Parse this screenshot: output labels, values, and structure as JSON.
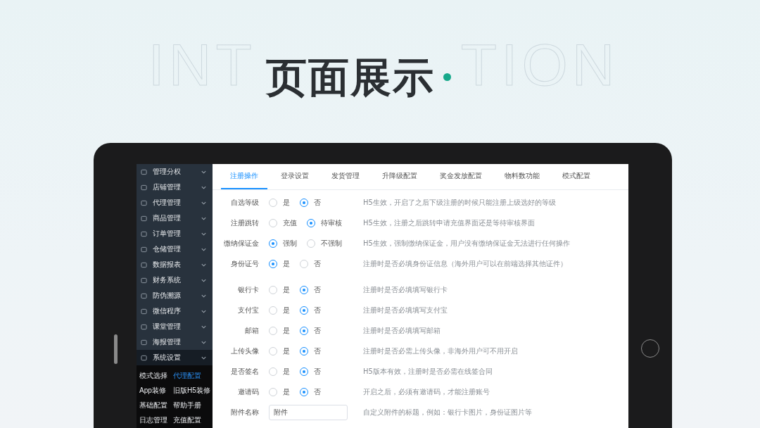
{
  "header": {
    "background_word_parts": [
      "INT",
      "TION"
    ],
    "title": "页面展示"
  },
  "sidebar": {
    "items": [
      {
        "label": "管理分权",
        "expanded": false
      },
      {
        "label": "店铺管理",
        "expanded": false
      },
      {
        "label": "代理管理",
        "expanded": false
      },
      {
        "label": "商品管理",
        "expanded": false
      },
      {
        "label": "订单管理",
        "expanded": false
      },
      {
        "label": "仓储管理",
        "expanded": false
      },
      {
        "label": "数据报表",
        "expanded": false
      },
      {
        "label": "财务系统",
        "expanded": false
      },
      {
        "label": "防伪溯源",
        "expanded": false
      },
      {
        "label": "微信程序",
        "expanded": false
      },
      {
        "label": "课堂管理",
        "expanded": false
      },
      {
        "label": "海报管理",
        "expanded": false
      },
      {
        "label": "系统设置",
        "expanded": true
      }
    ],
    "submenu": [
      {
        "label": "模式选择",
        "selected": false
      },
      {
        "label": "代理配置",
        "selected": true
      },
      {
        "label": "App装修",
        "selected": false
      },
      {
        "label": "旧版H5装修",
        "selected": false
      },
      {
        "label": "基础配置",
        "selected": false
      },
      {
        "label": "帮助手册",
        "selected": false
      },
      {
        "label": "日志管理",
        "selected": false
      },
      {
        "label": "充值配置",
        "selected": false
      }
    ]
  },
  "tabs": [
    {
      "label": "注册操作",
      "selected": true
    },
    {
      "label": "登录设置",
      "selected": false
    },
    {
      "label": "发货管理",
      "selected": false
    },
    {
      "label": "升降级配置",
      "selected": false
    },
    {
      "label": "奖金发放配置",
      "selected": false
    },
    {
      "label": "物料数功能",
      "selected": false
    },
    {
      "label": "模式配置",
      "selected": false
    }
  ],
  "form": {
    "rows": [
      {
        "kind": "radio",
        "label": "自选等级",
        "options": [
          {
            "label": "是",
            "selected": false
          },
          {
            "label": "否",
            "selected": true
          }
        ],
        "description": "H5生效，开启了之后下级注册的时候只能注册上级选好的等级"
      },
      {
        "kind": "radio",
        "label": "注册跳转",
        "options": [
          {
            "label": "充值",
            "selected": false
          },
          {
            "label": "待审核",
            "selected": true
          }
        ],
        "description": "H5生效，注册之后跳转申请充值界面还是等待审核界面"
      },
      {
        "kind": "radio",
        "label": "缴纳保证金",
        "options": [
          {
            "label": "强制",
            "selected": true
          },
          {
            "label": "不强制",
            "selected": false
          }
        ],
        "description": "H5生效，强制缴纳保证金，用户没有缴纳保证金无法进行任何操作"
      },
      {
        "kind": "radio",
        "label": "身份证号",
        "options": [
          {
            "label": "是",
            "selected": true
          },
          {
            "label": "否",
            "selected": false
          }
        ],
        "description": "注册时是否必填身份证信息（海外用户可以在前端选择其他证件）",
        "gap_after": true
      },
      {
        "kind": "radio",
        "label": "银行卡",
        "options": [
          {
            "label": "是",
            "selected": false
          },
          {
            "label": "否",
            "selected": true
          }
        ],
        "description": "注册时是否必填填写银行卡"
      },
      {
        "kind": "radio",
        "label": "支付宝",
        "options": [
          {
            "label": "是",
            "selected": false
          },
          {
            "label": "否",
            "selected": true
          }
        ],
        "description": "注册时是否必填填写支付宝"
      },
      {
        "kind": "radio",
        "label": "邮箱",
        "options": [
          {
            "label": "是",
            "selected": false
          },
          {
            "label": "否",
            "selected": true
          }
        ],
        "description": "注册时是否必填填写邮箱"
      },
      {
        "kind": "radio",
        "label": "上传头像",
        "options": [
          {
            "label": "是",
            "selected": false
          },
          {
            "label": "否",
            "selected": true
          }
        ],
        "description": "注册时是否必需上传头像，非海外用户可不用开启"
      },
      {
        "kind": "radio",
        "label": "是否签名",
        "options": [
          {
            "label": "是",
            "selected": false
          },
          {
            "label": "否",
            "selected": true
          }
        ],
        "description": "H5版本有效，注册时是否必需在线签合同"
      },
      {
        "kind": "radio",
        "label": "邀请码",
        "options": [
          {
            "label": "是",
            "selected": false
          },
          {
            "label": "否",
            "selected": true
          }
        ],
        "description": "开启之后，必须有邀请码，才能注册账号"
      },
      {
        "kind": "input",
        "label": "附件名称",
        "value": "附件",
        "description": "自定义附件的标题，例如：银行卡图片，身份证图片等"
      }
    ]
  }
}
